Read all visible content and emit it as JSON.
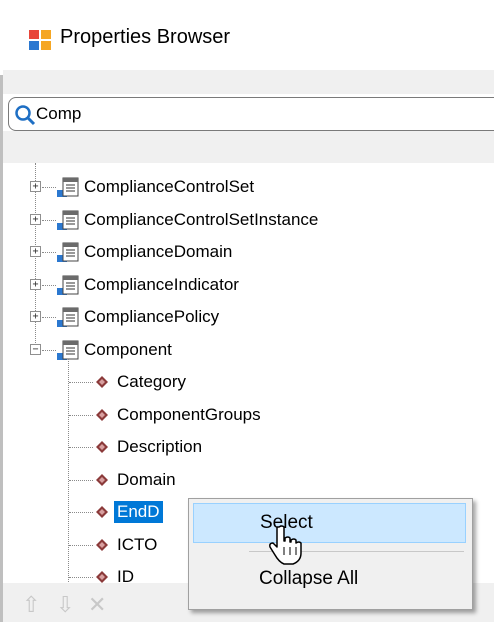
{
  "title_bar": {
    "title": "Properties Browser",
    "icon": "properties-browser-icon"
  },
  "search": {
    "value": "Comp",
    "icon": "search-icon"
  },
  "tree": {
    "classes": [
      {
        "label": "ComplianceControlSet",
        "expanded": false
      },
      {
        "label": "ComplianceControlSetInstance",
        "expanded": false
      },
      {
        "label": "ComplianceDomain",
        "expanded": false
      },
      {
        "label": "ComplianceIndicator",
        "expanded": false
      },
      {
        "label": "CompliancePolicy",
        "expanded": false
      },
      {
        "label": "Component",
        "expanded": true
      }
    ],
    "properties": [
      {
        "label": "Category"
      },
      {
        "label": "ComponentGroups"
      },
      {
        "label": "Description"
      },
      {
        "label": "Domain"
      },
      {
        "label": "EndD",
        "selected": true
      },
      {
        "label": "ICTO"
      },
      {
        "label": "ID"
      }
    ]
  },
  "context_menu": {
    "items": [
      {
        "label": "Select",
        "hover": true
      },
      {
        "label": "Collapse All"
      }
    ]
  },
  "bottom_toolbar": {
    "buttons": [
      {
        "icon": "arrow-up-icon",
        "glyph": "⇧"
      },
      {
        "icon": "arrow-down-icon",
        "glyph": "⇩"
      },
      {
        "icon": "close-icon",
        "glyph": "✕"
      }
    ]
  },
  "colors": {
    "selection": "#0078d7",
    "menu_hover": "#cce8ff",
    "diamond": "#8b3a3a"
  }
}
